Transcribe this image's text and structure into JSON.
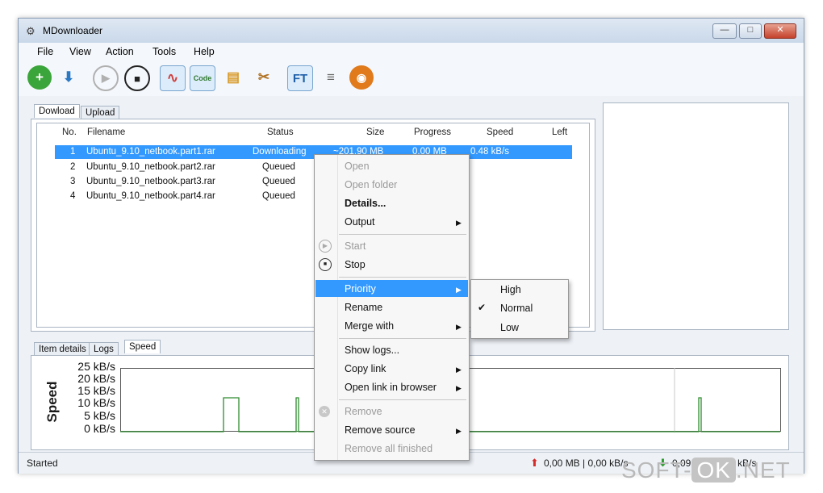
{
  "window": {
    "title": "MDownloader",
    "minimize_glyph": "—",
    "maximize_glyph": "□",
    "close_glyph": "✕"
  },
  "menu": [
    "File",
    "View",
    "Action",
    "Tools",
    "Help"
  ],
  "toolbar": [
    {
      "icon": "add-icon",
      "glyph": "+",
      "color": "#3aa53a"
    },
    {
      "icon": "download-arrow-icon",
      "glyph": "⬇",
      "color": "#2b78c4"
    },
    {
      "icon": "play-icon",
      "glyph": "▶",
      "color": "#b0b0b0"
    },
    {
      "icon": "stop-icon",
      "glyph": "■",
      "color": "#222222"
    },
    {
      "icon": "graph-icon",
      "glyph": "∿",
      "color": "#d04040"
    },
    {
      "icon": "code-icon",
      "glyph": "Code",
      "color": "#2f7a2f"
    },
    {
      "icon": "package-icon",
      "glyph": "▤",
      "color": "#d99b2b"
    },
    {
      "icon": "tools-icon",
      "glyph": "✂",
      "color": "#b07020"
    },
    {
      "icon": "ft-icon",
      "glyph": "FT",
      "color": "#1f5fa8"
    },
    {
      "icon": "database-icon",
      "glyph": "≡",
      "color": "#666666"
    },
    {
      "icon": "rss-icon",
      "glyph": "◉",
      "color": "#e07a1a"
    }
  ],
  "top_tabs": [
    "Dowload",
    "Upload"
  ],
  "columns": [
    "No.",
    "Filename",
    "Status",
    "Size",
    "Progress",
    "Speed",
    "Left"
  ],
  "rows": [
    {
      "no": "1",
      "filename": "Ubuntu_9.10_netbook.part1.rar",
      "status": "Downloading",
      "size": "~201,90 MB",
      "progress": "0,00 MB",
      "speed": "0.48 kB/s",
      "selected": true
    },
    {
      "no": "2",
      "filename": "Ubuntu_9.10_netbook.part2.rar",
      "status": "Queued"
    },
    {
      "no": "3",
      "filename": "Ubuntu_9.10_netbook.part3.rar",
      "status": "Queued"
    },
    {
      "no": "4",
      "filename": "Ubuntu_9.10_netbook.part4.rar",
      "status": "Queued"
    }
  ],
  "bottom_tabs": [
    "Item details",
    "Logs",
    "Speed"
  ],
  "speed_chart": {
    "ylabel": "Speed",
    "ticks": [
      "25 kB/s",
      "20 kB/s",
      "15 kB/s",
      "10 kB/s",
      "5 kB/s",
      "0 kB/s"
    ]
  },
  "context_menu": {
    "items": [
      {
        "label": "Open",
        "disabled": true
      },
      {
        "label": "Open folder",
        "disabled": true
      },
      {
        "label": "Details...",
        "bold": true
      },
      {
        "label": "Output",
        "submenu": true
      },
      {
        "label": "Start",
        "disabled": true
      },
      {
        "label": "Stop"
      },
      {
        "label": "Priority",
        "submenu": true,
        "highlighted": true
      },
      {
        "label": "Rename"
      },
      {
        "label": "Merge with",
        "submenu": true
      },
      {
        "label": "Show logs..."
      },
      {
        "label": "Copy link",
        "submenu": true
      },
      {
        "label": "Open link in browser",
        "submenu": true
      },
      {
        "label": "Remove",
        "disabled": true
      },
      {
        "label": "Remove source",
        "submenu": true
      },
      {
        "label": "Remove all finished",
        "disabled": true
      }
    ]
  },
  "priority_submenu": {
    "items": [
      "High",
      "Normal",
      "Low"
    ],
    "checked": "Normal"
  },
  "status": {
    "text": "Started",
    "upload": "0,00 MB | 0,00 kB/s",
    "download": "0,09 MB | 0,48 kB/s"
  },
  "watermark": {
    "soft": "SOFT-",
    "ok": "OK",
    "net": ".NET"
  },
  "colors": {
    "selection": "#3399ff",
    "window_bg": "#eef2f7",
    "chart_line": "#2e8b2e"
  }
}
